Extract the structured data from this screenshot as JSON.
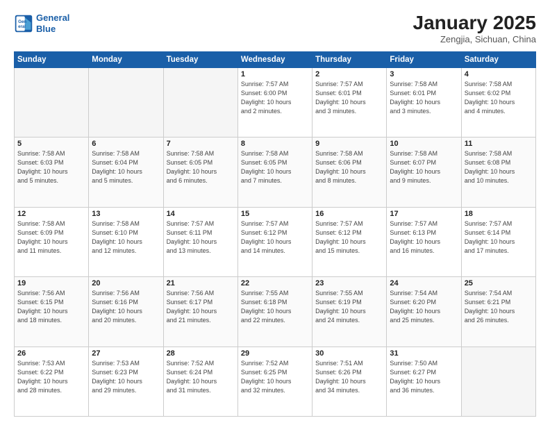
{
  "header": {
    "logo_line1": "General",
    "logo_line2": "Blue",
    "title": "January 2025",
    "subtitle": "Zengjia, Sichuan, China"
  },
  "weekdays": [
    "Sunday",
    "Monday",
    "Tuesday",
    "Wednesday",
    "Thursday",
    "Friday",
    "Saturday"
  ],
  "weeks": [
    [
      {
        "day": "",
        "info": ""
      },
      {
        "day": "",
        "info": ""
      },
      {
        "day": "",
        "info": ""
      },
      {
        "day": "1",
        "info": "Sunrise: 7:57 AM\nSunset: 6:00 PM\nDaylight: 10 hours\nand 2 minutes."
      },
      {
        "day": "2",
        "info": "Sunrise: 7:57 AM\nSunset: 6:01 PM\nDaylight: 10 hours\nand 3 minutes."
      },
      {
        "day": "3",
        "info": "Sunrise: 7:58 AM\nSunset: 6:01 PM\nDaylight: 10 hours\nand 3 minutes."
      },
      {
        "day": "4",
        "info": "Sunrise: 7:58 AM\nSunset: 6:02 PM\nDaylight: 10 hours\nand 4 minutes."
      }
    ],
    [
      {
        "day": "5",
        "info": "Sunrise: 7:58 AM\nSunset: 6:03 PM\nDaylight: 10 hours\nand 5 minutes."
      },
      {
        "day": "6",
        "info": "Sunrise: 7:58 AM\nSunset: 6:04 PM\nDaylight: 10 hours\nand 5 minutes."
      },
      {
        "day": "7",
        "info": "Sunrise: 7:58 AM\nSunset: 6:05 PM\nDaylight: 10 hours\nand 6 minutes."
      },
      {
        "day": "8",
        "info": "Sunrise: 7:58 AM\nSunset: 6:05 PM\nDaylight: 10 hours\nand 7 minutes."
      },
      {
        "day": "9",
        "info": "Sunrise: 7:58 AM\nSunset: 6:06 PM\nDaylight: 10 hours\nand 8 minutes."
      },
      {
        "day": "10",
        "info": "Sunrise: 7:58 AM\nSunset: 6:07 PM\nDaylight: 10 hours\nand 9 minutes."
      },
      {
        "day": "11",
        "info": "Sunrise: 7:58 AM\nSunset: 6:08 PM\nDaylight: 10 hours\nand 10 minutes."
      }
    ],
    [
      {
        "day": "12",
        "info": "Sunrise: 7:58 AM\nSunset: 6:09 PM\nDaylight: 10 hours\nand 11 minutes."
      },
      {
        "day": "13",
        "info": "Sunrise: 7:58 AM\nSunset: 6:10 PM\nDaylight: 10 hours\nand 12 minutes."
      },
      {
        "day": "14",
        "info": "Sunrise: 7:57 AM\nSunset: 6:11 PM\nDaylight: 10 hours\nand 13 minutes."
      },
      {
        "day": "15",
        "info": "Sunrise: 7:57 AM\nSunset: 6:12 PM\nDaylight: 10 hours\nand 14 minutes."
      },
      {
        "day": "16",
        "info": "Sunrise: 7:57 AM\nSunset: 6:12 PM\nDaylight: 10 hours\nand 15 minutes."
      },
      {
        "day": "17",
        "info": "Sunrise: 7:57 AM\nSunset: 6:13 PM\nDaylight: 10 hours\nand 16 minutes."
      },
      {
        "day": "18",
        "info": "Sunrise: 7:57 AM\nSunset: 6:14 PM\nDaylight: 10 hours\nand 17 minutes."
      }
    ],
    [
      {
        "day": "19",
        "info": "Sunrise: 7:56 AM\nSunset: 6:15 PM\nDaylight: 10 hours\nand 18 minutes."
      },
      {
        "day": "20",
        "info": "Sunrise: 7:56 AM\nSunset: 6:16 PM\nDaylight: 10 hours\nand 20 minutes."
      },
      {
        "day": "21",
        "info": "Sunrise: 7:56 AM\nSunset: 6:17 PM\nDaylight: 10 hours\nand 21 minutes."
      },
      {
        "day": "22",
        "info": "Sunrise: 7:55 AM\nSunset: 6:18 PM\nDaylight: 10 hours\nand 22 minutes."
      },
      {
        "day": "23",
        "info": "Sunrise: 7:55 AM\nSunset: 6:19 PM\nDaylight: 10 hours\nand 24 minutes."
      },
      {
        "day": "24",
        "info": "Sunrise: 7:54 AM\nSunset: 6:20 PM\nDaylight: 10 hours\nand 25 minutes."
      },
      {
        "day": "25",
        "info": "Sunrise: 7:54 AM\nSunset: 6:21 PM\nDaylight: 10 hours\nand 26 minutes."
      }
    ],
    [
      {
        "day": "26",
        "info": "Sunrise: 7:53 AM\nSunset: 6:22 PM\nDaylight: 10 hours\nand 28 minutes."
      },
      {
        "day": "27",
        "info": "Sunrise: 7:53 AM\nSunset: 6:23 PM\nDaylight: 10 hours\nand 29 minutes."
      },
      {
        "day": "28",
        "info": "Sunrise: 7:52 AM\nSunset: 6:24 PM\nDaylight: 10 hours\nand 31 minutes."
      },
      {
        "day": "29",
        "info": "Sunrise: 7:52 AM\nSunset: 6:25 PM\nDaylight: 10 hours\nand 32 minutes."
      },
      {
        "day": "30",
        "info": "Sunrise: 7:51 AM\nSunset: 6:26 PM\nDaylight: 10 hours\nand 34 minutes."
      },
      {
        "day": "31",
        "info": "Sunrise: 7:50 AM\nSunset: 6:27 PM\nDaylight: 10 hours\nand 36 minutes."
      },
      {
        "day": "",
        "info": ""
      }
    ]
  ]
}
